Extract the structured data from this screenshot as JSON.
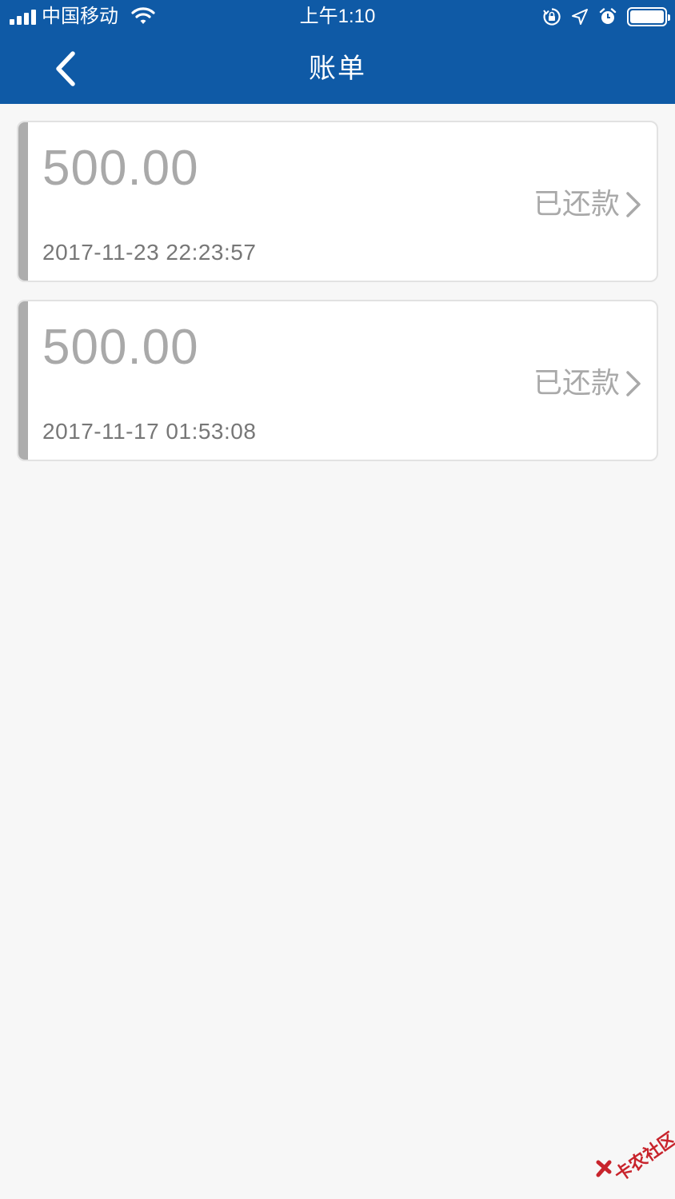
{
  "status_bar": {
    "carrier": "中国移动",
    "time": "上午1:10",
    "battery_level": 1.0
  },
  "nav": {
    "title": "账单"
  },
  "bills": [
    {
      "amount": "500.00",
      "date": "2017-11-23 22:23:57",
      "status": "已还款"
    },
    {
      "amount": "500.00",
      "date": "2017-11-17 01:53:08",
      "status": "已还款"
    }
  ],
  "watermark": {
    "text": "卡农社区"
  },
  "colors": {
    "header": "#0f5aa6",
    "background": "#f7f7f7",
    "card_bar": "#adadad",
    "watermark": "#c8242c"
  }
}
